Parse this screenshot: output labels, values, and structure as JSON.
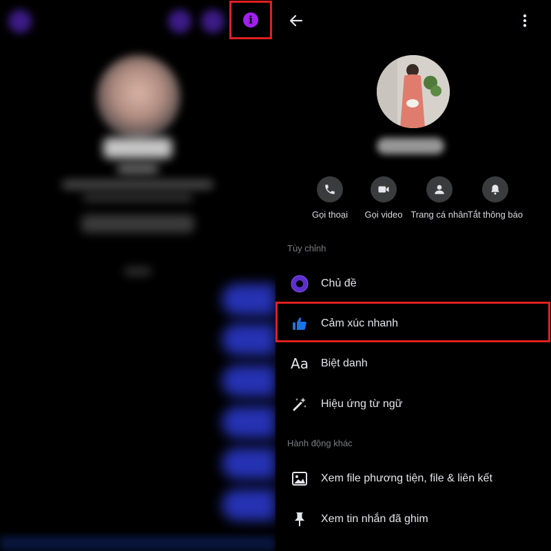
{
  "left_screen": {
    "info_button_glyph": "i"
  },
  "header": {
    "back_glyph": "←",
    "more_glyph": "⋮"
  },
  "actions": [
    {
      "label": "Gọi thoại",
      "icon": "phone-icon"
    },
    {
      "label": "Gọi video",
      "icon": "video-camera-icon"
    },
    {
      "label": "Trang cá nhân",
      "icon": "profile-icon"
    },
    {
      "label": "Tắt thông báo",
      "icon": "bell-icon"
    }
  ],
  "sections": {
    "customize": "Tùy chỉnh",
    "other_actions": "Hành động khác"
  },
  "menu": {
    "theme": "Chủ đề",
    "quick_reaction": "Cảm xúc nhanh",
    "nickname": "Biệt danh",
    "nickname_icon_text": "Aa",
    "word_effects": "Hiệu ứng từ ngữ",
    "view_media": "Xem file phương tiện, file & liên kết",
    "pinned_messages": "Xem tin nhắn đã ghim"
  },
  "colors": {
    "highlight_border": "#e02020",
    "info_button": "#a020f0",
    "quick_reaction_icon": "#1b74e4",
    "theme_icon": "#7b3fe4"
  }
}
